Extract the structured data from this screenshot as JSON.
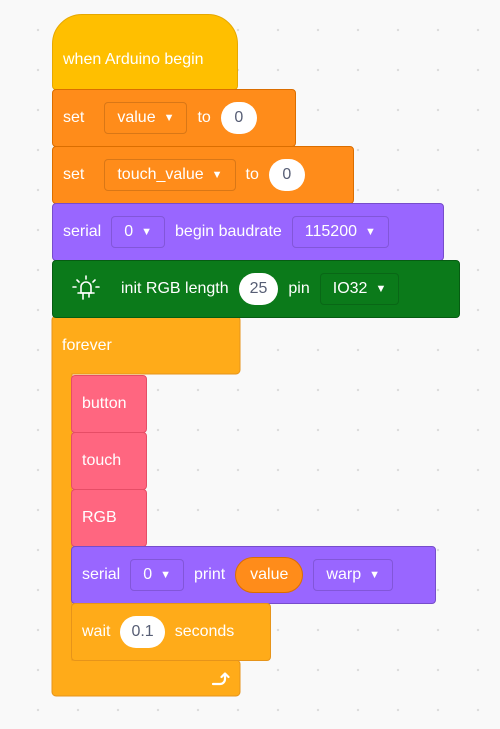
{
  "program": {
    "hat": {
      "label": "when Arduino begin"
    },
    "set_value": {
      "set_label": "set",
      "variable": "value",
      "to_label": "to",
      "amount": "0"
    },
    "set_touch": {
      "set_label": "set",
      "variable": "touch_value",
      "to_label": "to",
      "amount": "0"
    },
    "serial_begin": {
      "serial_label": "serial",
      "port": "0",
      "begin_label": "begin baudrate",
      "baudrate": "115200"
    },
    "init_rgb": {
      "icon": "led-icon",
      "label": "init RGB length",
      "length": "25",
      "pin_label": "pin",
      "pin": "IO32"
    },
    "forever": {
      "label": "forever",
      "loop_icon": "loop-arrow-icon"
    },
    "body": {
      "button_block": "button",
      "touch_block": "touch",
      "rgb_block": "RGB",
      "serial_print": {
        "serial_label": "serial",
        "port": "0",
        "print_label": "print",
        "variable": "value",
        "mode": "warp"
      },
      "wait": {
        "wait_label": "wait",
        "seconds": "0.1",
        "seconds_label": "seconds"
      }
    }
  },
  "colors": {
    "events": "#ffbf00",
    "variables": "#ff8c1a",
    "serial": "#9966ff",
    "rgb": "#0b7a1a",
    "custom": "#ff6680",
    "control": "#ffab19"
  }
}
